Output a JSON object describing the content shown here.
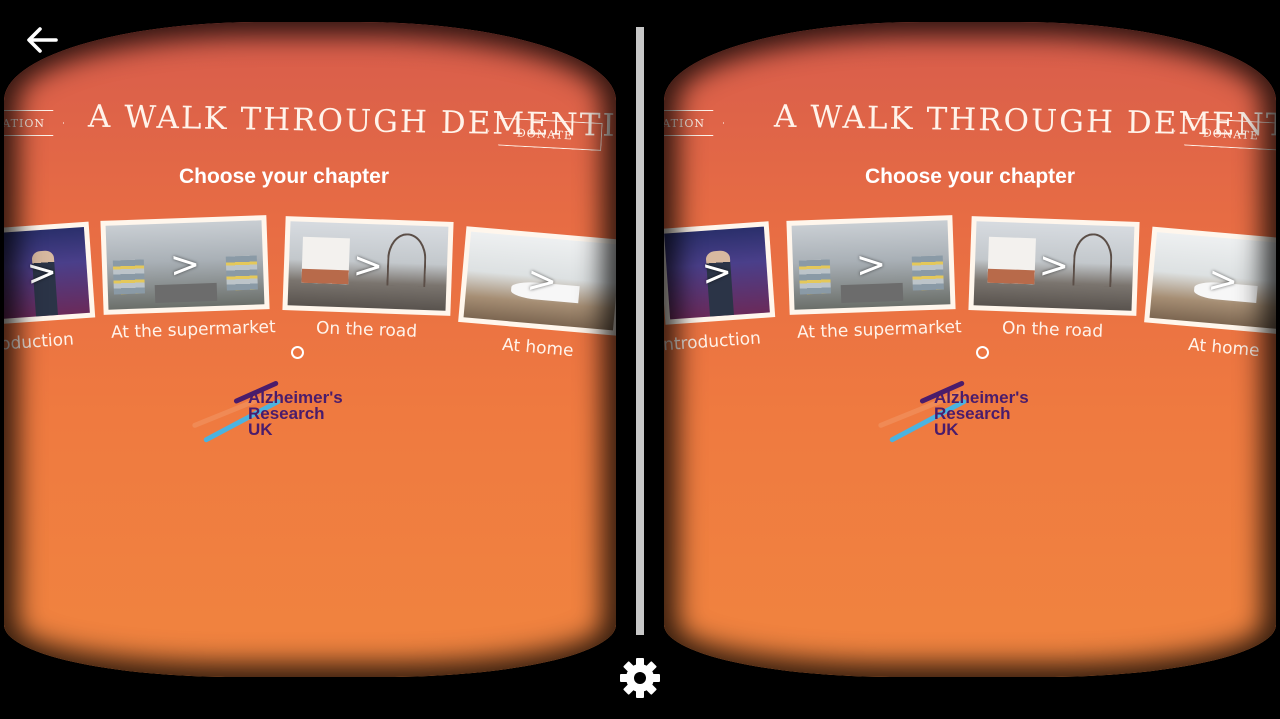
{
  "app": {
    "title": "A WALK THROUGH DEMENTIA",
    "subtitle": "Choose your chapter",
    "info_tab": "RMATION",
    "donate_tab": "DONATE"
  },
  "chapters": [
    {
      "label": "Introduction",
      "left_view_label": "oduction",
      "icon": "play-arrow-icon"
    },
    {
      "label": "At the supermarket",
      "icon": "play-arrow-icon"
    },
    {
      "label": "On the road",
      "icon": "play-arrow-icon"
    },
    {
      "label": "At home",
      "icon": "play-arrow-icon"
    }
  ],
  "logo": {
    "line1": "Alzheimer's",
    "line2": "Research",
    "line3": "UK"
  },
  "controls": {
    "back_icon": "back-arrow-icon",
    "settings_icon": "gear-icon"
  },
  "colors": {
    "gradient_top": "#d75c4c",
    "gradient_bottom": "#f0843f",
    "logo_purple": "#4a1c6b"
  }
}
